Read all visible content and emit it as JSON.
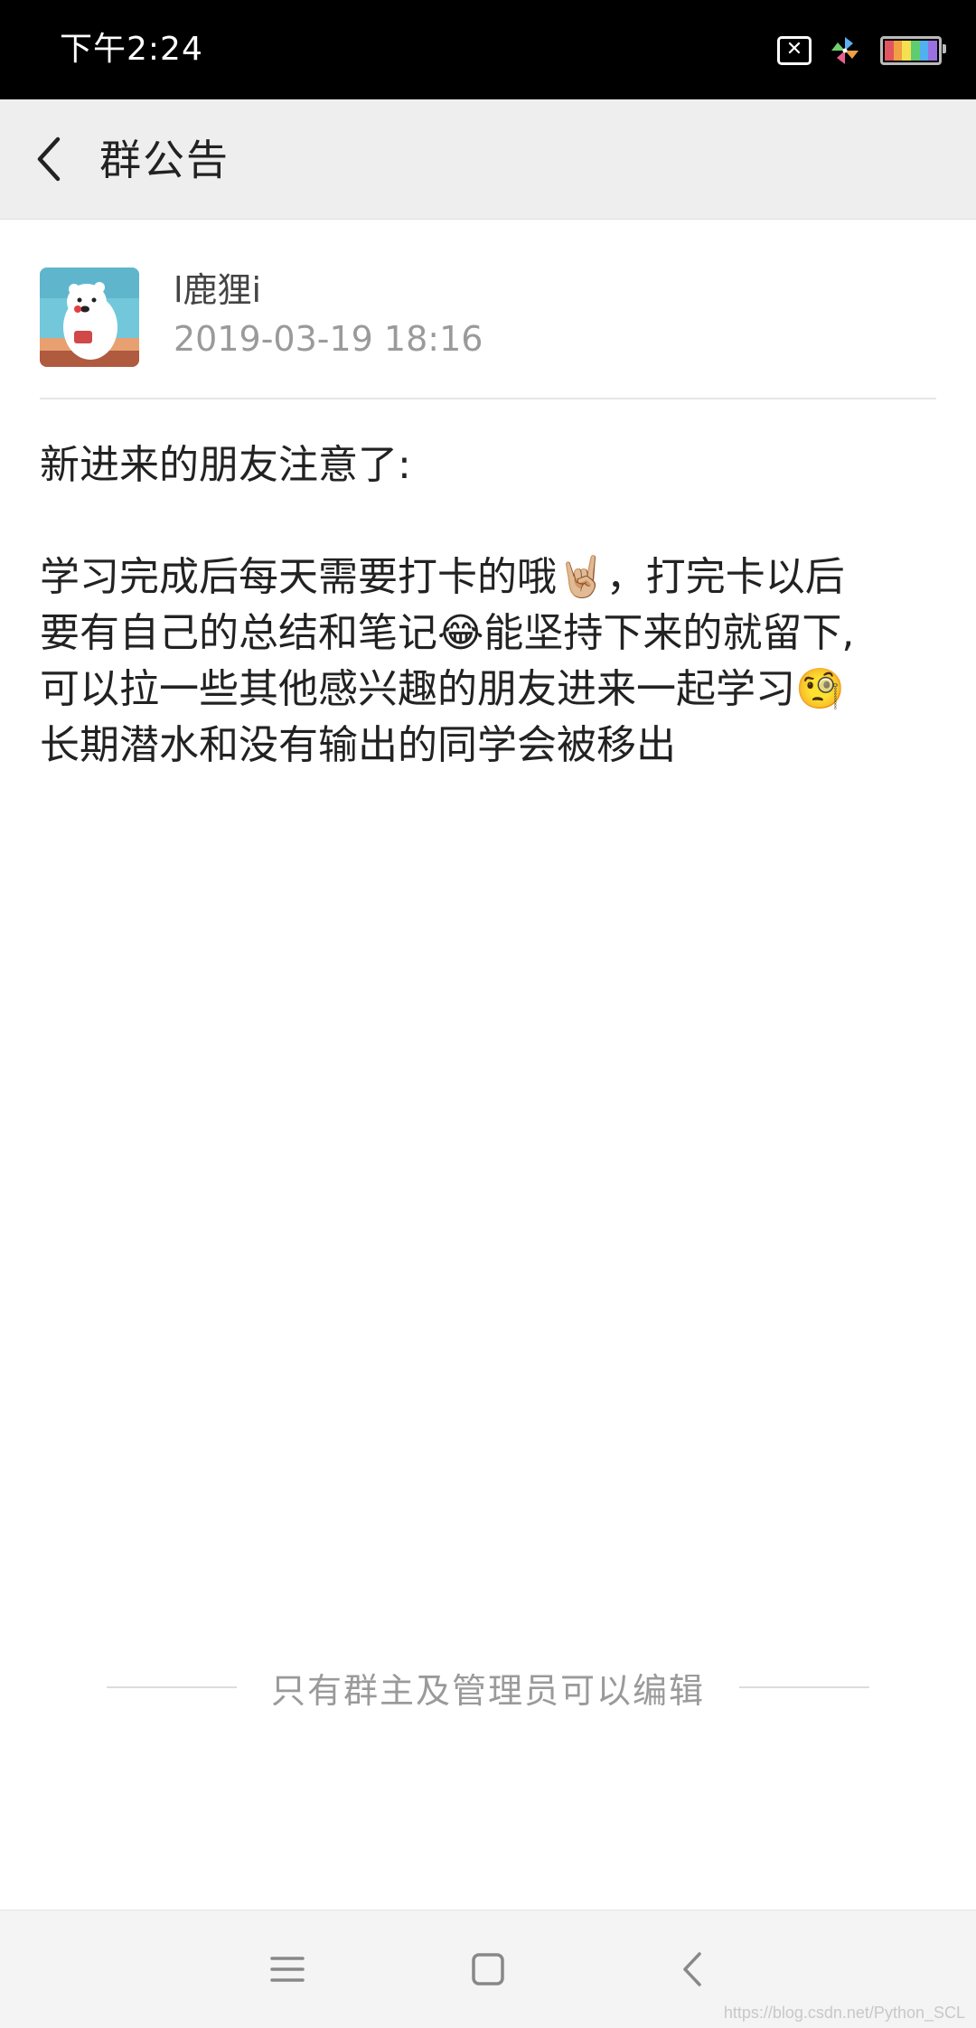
{
  "status_bar": {
    "time": "下午2:24",
    "icons": [
      "sim-off-icon",
      "pinwheel-icon",
      "battery-icon"
    ]
  },
  "header": {
    "back_icon": "chevron-left-icon",
    "title": "群公告"
  },
  "author": {
    "avatar_icon": "polar-bear-avatar",
    "name": "l鹿狸i",
    "timestamp": "2019-03-19 18:16"
  },
  "announcement": {
    "heading": "新进来的朋友注意了:",
    "body_lines": [
      "学习完成后每天需要打卡的哦🤘🏼，打完卡以后",
      "要有自己的总结和笔记😂能坚持下来的就留下,",
      "可以拉一些其他感兴趣的朋友进来一起学习🧐",
      "长期潜水和没有输出的同学会被移出"
    ]
  },
  "footer_note": "只有群主及管理员可以编辑",
  "nav_bar": {
    "buttons": [
      "menu-icon",
      "home-icon",
      "back-icon"
    ]
  },
  "watermark": "https://blog.csdn.net/Python_SCL",
  "colors": {
    "status_bar_bg": "#000000",
    "header_bg": "#eeeeee",
    "text_primary": "#222222",
    "text_secondary": "#9a9a9a"
  }
}
